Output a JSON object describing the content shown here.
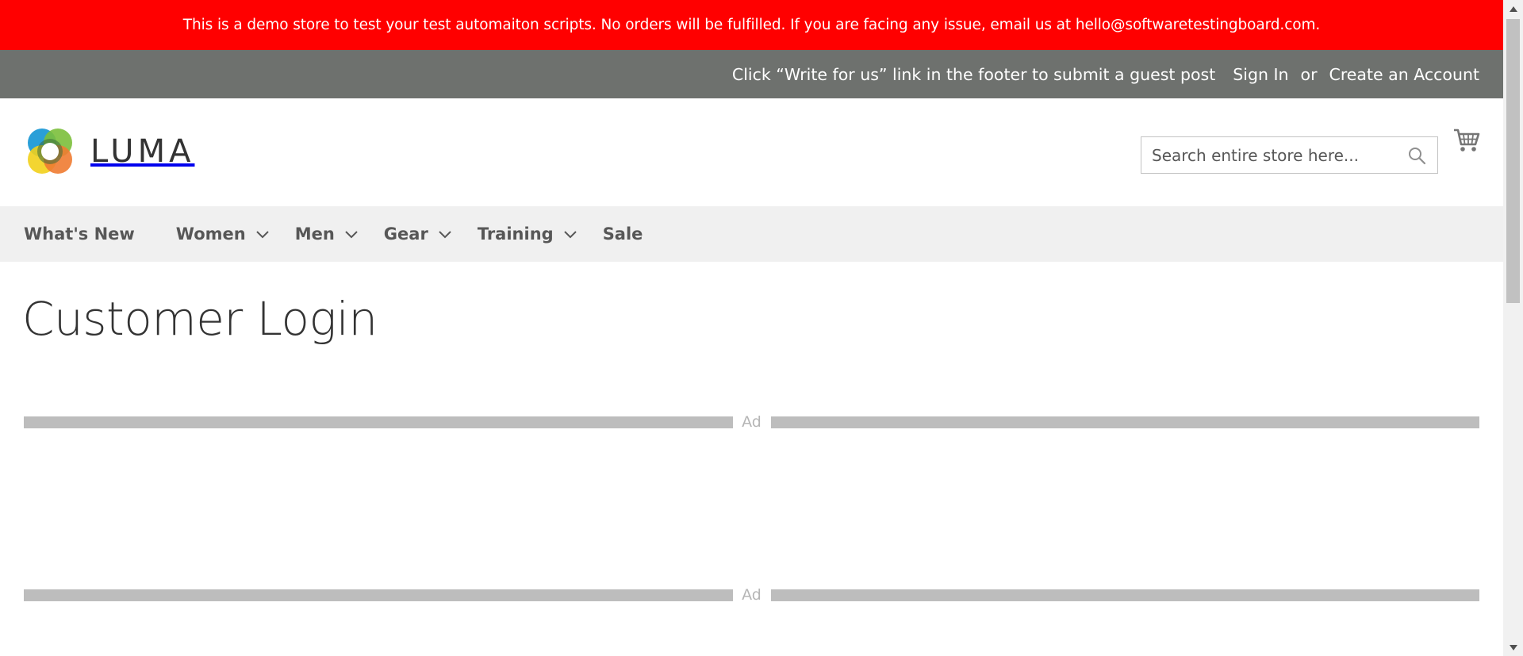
{
  "notice": {
    "text": "This is a demo store to test your test automaiton scripts. No orders will be fulfilled. If you are facing any issue, email us at hello@softwaretestingboard.com."
  },
  "panel_header": {
    "guest_post_message": "Click “Write for us” link in the footer to submit a guest post",
    "sign_in": "Sign In",
    "or": "or",
    "create_account": "Create an Account"
  },
  "header": {
    "logo_text": "LUMA",
    "search_placeholder": "Search entire store here..."
  },
  "nav": {
    "items": [
      {
        "label": "What's New",
        "has_dropdown": false
      },
      {
        "label": "Women",
        "has_dropdown": true
      },
      {
        "label": "Men",
        "has_dropdown": true
      },
      {
        "label": "Gear",
        "has_dropdown": true
      },
      {
        "label": "Training",
        "has_dropdown": true
      },
      {
        "label": "Sale",
        "has_dropdown": false
      }
    ]
  },
  "main": {
    "page_title": "Customer Login",
    "ad_label_1": "Ad",
    "ad_label_2": "Ad"
  },
  "colors": {
    "notice_bg": "#ff0000",
    "panel_bg": "#6e716e",
    "nav_bg": "#f0f0f0"
  },
  "icons": {
    "search": "search-icon",
    "cart": "cart-icon",
    "chevron": "chevron-down-icon"
  }
}
